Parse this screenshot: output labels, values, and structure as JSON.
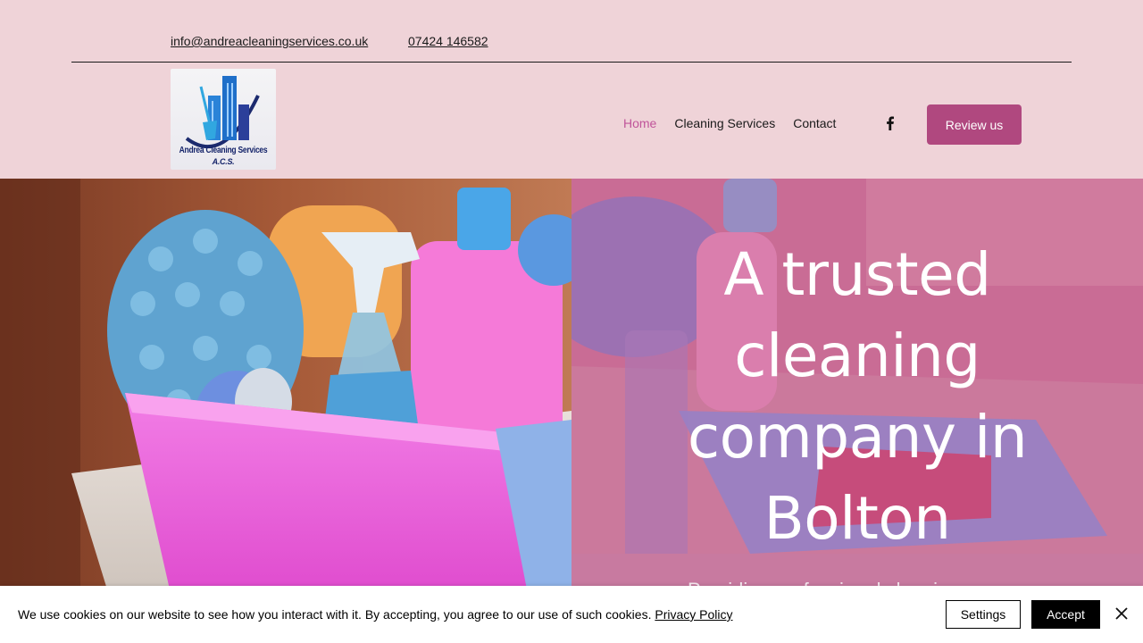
{
  "contact": {
    "email": "info@andreacleaningservices.co.uk",
    "phone": "07424 146582"
  },
  "logo": {
    "name": "Andrea Cleaning Services",
    "abbr": "A.C.S."
  },
  "nav": {
    "items": [
      {
        "label": "Home",
        "active": true
      },
      {
        "label": "Cleaning Services",
        "active": false
      },
      {
        "label": "Contact",
        "active": false
      }
    ],
    "social_icon": "facebook-icon",
    "review_label": "Review us"
  },
  "hero": {
    "title_lines": [
      "A trusted",
      "cleaning",
      "company in",
      "Bolton"
    ],
    "subtitle": "Providing professional cleaning"
  },
  "cookie_banner": {
    "message": "We use cookies on our website to see how you interact with it. By accepting, you agree to our use of such cookies.",
    "policy_link": "Privacy Policy",
    "settings_label": "Settings",
    "accept_label": "Accept",
    "close_icon": "close-icon"
  },
  "colors": {
    "background": "#efd3d8",
    "accent": "#b0487f",
    "nav_active": "#c0549a"
  }
}
